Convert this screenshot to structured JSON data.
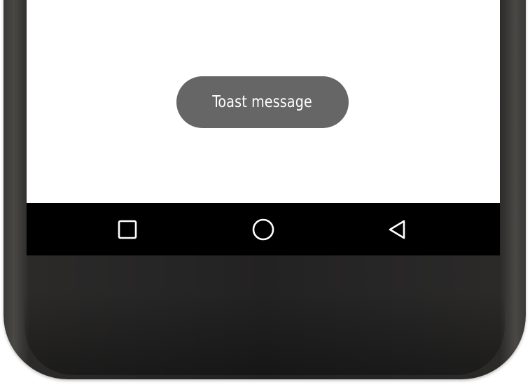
{
  "toast": {
    "message": "Toast message"
  },
  "navigation_bar": {
    "buttons": [
      {
        "id": "recents",
        "icon": "square-recents-icon"
      },
      {
        "id": "home",
        "icon": "circle-home-icon"
      },
      {
        "id": "back",
        "icon": "triangle-back-icon"
      }
    ]
  },
  "colors": {
    "screen_background": "#ffffff",
    "toast_background": "#666666",
    "toast_text": "#ffffff",
    "navbar_background": "#000000",
    "nav_icon": "#ffffff",
    "phone_body": "#232223"
  }
}
